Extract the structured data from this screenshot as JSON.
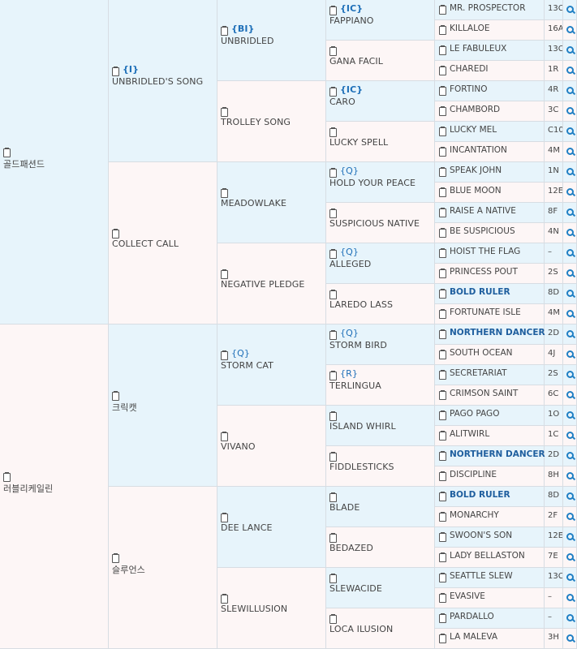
{
  "gen1": [
    {
      "name": "골드패션드",
      "badge": ""
    },
    {
      "name": "러블리케일린",
      "badge": ""
    }
  ],
  "gen2": [
    {
      "name": "UNBRIDLED'S SONG",
      "badge": "{I}"
    },
    {
      "name": "COLLECT CALL",
      "badge": ""
    },
    {
      "name": "크릭캣",
      "badge": ""
    },
    {
      "name": "슬루언스",
      "badge": ""
    }
  ],
  "gen3": [
    {
      "name": "UNBRIDLED",
      "badge": "{BI}"
    },
    {
      "name": "TROLLEY SONG",
      "badge": ""
    },
    {
      "name": "MEADOWLAKE",
      "badge": ""
    },
    {
      "name": "NEGATIVE PLEDGE",
      "badge": ""
    },
    {
      "name": "STORM CAT",
      "badge": "{Q}"
    },
    {
      "name": "VIVANO",
      "badge": ""
    },
    {
      "name": "DEE LANCE",
      "badge": ""
    },
    {
      "name": "SLEWILLUSION",
      "badge": ""
    }
  ],
  "gen4": [
    {
      "name": "FAPPIANO",
      "badge": "{IC}"
    },
    {
      "name": "GANA FACIL",
      "badge": ""
    },
    {
      "name": "CARO",
      "badge": "{IC}"
    },
    {
      "name": "LUCKY SPELL",
      "badge": ""
    },
    {
      "name": "HOLD YOUR PEACE",
      "badge": "{Q}"
    },
    {
      "name": "SUSPICIOUS NATIVE",
      "badge": ""
    },
    {
      "name": "ALLEGED",
      "badge": "{Q}"
    },
    {
      "name": "LAREDO LASS",
      "badge": ""
    },
    {
      "name": "STORM BIRD",
      "badge": "{Q}"
    },
    {
      "name": "TERLINGUA",
      "badge": "{R}"
    },
    {
      "name": "ISLAND WHIRL",
      "badge": ""
    },
    {
      "name": "FIDDLESTICKS",
      "badge": ""
    },
    {
      "name": "BLADE",
      "badge": ""
    },
    {
      "name": "BEDAZED",
      "badge": ""
    },
    {
      "name": "SLEWACIDE",
      "badge": ""
    },
    {
      "name": "LOCA ILUSION",
      "badge": ""
    }
  ],
  "gen5": [
    {
      "name": "MR. PROSPECTOR",
      "code": "13C",
      "bold": false
    },
    {
      "name": "KILLALOE",
      "code": "16A",
      "bold": false
    },
    {
      "name": "LE FABULEUX",
      "code": "13C",
      "bold": false
    },
    {
      "name": "CHAREDI",
      "code": "1R",
      "bold": false
    },
    {
      "name": "FORTINO",
      "code": "4R",
      "bold": false
    },
    {
      "name": "CHAMBORD",
      "code": "3C",
      "bold": false
    },
    {
      "name": "LUCKY MEL",
      "code": "C10",
      "bold": false
    },
    {
      "name": "INCANTATION",
      "code": "4M",
      "bold": false
    },
    {
      "name": "SPEAK JOHN",
      "code": "1N",
      "bold": false
    },
    {
      "name": "BLUE MOON",
      "code": "12E",
      "bold": false
    },
    {
      "name": "RAISE A NATIVE",
      "code": "8F",
      "bold": false
    },
    {
      "name": "BE SUSPICIOUS",
      "code": "4N",
      "bold": false
    },
    {
      "name": "HOIST THE FLAG",
      "code": "–",
      "bold": false
    },
    {
      "name": "PRINCESS POUT",
      "code": "2S",
      "bold": false
    },
    {
      "name": "BOLD RULER",
      "code": "8D",
      "bold": true
    },
    {
      "name": "FORTUNATE ISLE",
      "code": "4M",
      "bold": false
    },
    {
      "name": "NORTHERN DANCER",
      "code": "2D",
      "bold": true
    },
    {
      "name": "SOUTH OCEAN",
      "code": "4J",
      "bold": false
    },
    {
      "name": "SECRETARIAT",
      "code": "2S",
      "bold": false
    },
    {
      "name": "CRIMSON SAINT",
      "code": "6C",
      "bold": false
    },
    {
      "name": "PAGO PAGO",
      "code": "1O",
      "bold": false
    },
    {
      "name": "ALITWIRL",
      "code": "1C",
      "bold": false
    },
    {
      "name": "NORTHERN DANCER",
      "code": "2D",
      "bold": true
    },
    {
      "name": "DISCIPLINE",
      "code": "8H",
      "bold": false
    },
    {
      "name": "BOLD RULER",
      "code": "8D",
      "bold": true
    },
    {
      "name": "MONARCHY",
      "code": "2F",
      "bold": false
    },
    {
      "name": "SWOON'S SON",
      "code": "12E",
      "bold": false
    },
    {
      "name": "LADY BELLASTON",
      "code": "7E",
      "bold": false
    },
    {
      "name": "SEATTLE SLEW",
      "code": "13C",
      "bold": false
    },
    {
      "name": "EVASIVE",
      "code": "–",
      "bold": false
    },
    {
      "name": "PARDALLO",
      "code": "–",
      "bold": false
    },
    {
      "name": "LA MALEVA",
      "code": "3H",
      "bold": false
    }
  ],
  "icons": {
    "pedigree": "clipboard-icon",
    "search": "magnifier-icon"
  },
  "colors": {
    "sire_bg": "#e7f4fb",
    "dam_bg": "#fdf6f6",
    "link": "#1e6fb8"
  }
}
